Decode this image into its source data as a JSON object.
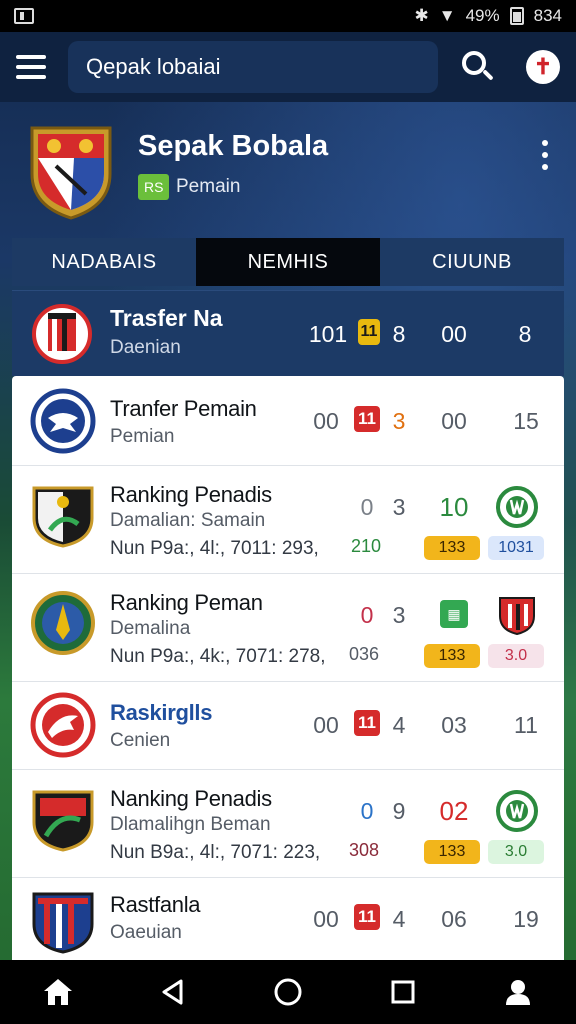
{
  "status": {
    "signal": "≈",
    "battery": "49%",
    "time": "834"
  },
  "search": {
    "value": "Qepak lobaiai"
  },
  "club": {
    "name": "Sepak Bobala",
    "badge": "RS",
    "subtitle": "Pemain"
  },
  "tabs": [
    {
      "label": "NADABAIS"
    },
    {
      "label": "NEMHIS"
    },
    {
      "label": "CIUUNB"
    }
  ],
  "featured": {
    "title": "Trasfer Na",
    "subtitle": "Daenian",
    "score_a": "101",
    "card": "11",
    "score_b": "8",
    "score_c": "00",
    "score_d": "8"
  },
  "rows": [
    {
      "title": "Tranfer Pemain",
      "subtitle": "Pemian",
      "n1": "00",
      "card": "11",
      "n2": "3",
      "n3": "00",
      "n4": "15"
    },
    {
      "title": "Ranking Penadis",
      "subtitle": "Damalian: Samain",
      "detail": "Nun P9a:, 4l:, 7011: 293,",
      "n1": "0",
      "n2": "3",
      "n3": "10",
      "d1": "210",
      "d2": "133",
      "d3": "1031"
    },
    {
      "title": "Ranking Peman",
      "subtitle": "Demalina",
      "detail": "Nun P9a:, 4k:, 7071: 278,",
      "n1": "0",
      "n2": "3",
      "d1": "036",
      "d2": "133",
      "d3": "3.0"
    },
    {
      "title": "Raskirglls",
      "subtitle": "Cenien",
      "n1": "00",
      "card": "11",
      "n2": "4",
      "n3": "03",
      "n4": "11"
    },
    {
      "title": "Nanking Penadis",
      "subtitle": "Dlamalihgn Beman",
      "detail": "Nun B9a:, 4l:, 7071: 223,",
      "n1": "0",
      "n2": "9",
      "n3": "02",
      "d1": "308",
      "d2": "133",
      "d3": "3.0"
    },
    {
      "title": "Rastfanla",
      "subtitle": "Oaeuian",
      "n1": "00",
      "card": "11",
      "n2": "4",
      "n3": "06",
      "n4": "19"
    }
  ],
  "icons": {
    "menu": "hamburger-icon",
    "search": "search-icon",
    "add": "red-cross-icon",
    "more": "kebab-menu-icon",
    "home": "home-icon",
    "back": "back-icon",
    "circle": "home-circle-icon",
    "recent": "recent-apps-icon",
    "profile": "profile-icon"
  },
  "colors": {
    "navy": "#0f2240",
    "tab_active": "#05080d",
    "red": "#d52b2b",
    "yellow": "#f2b51b",
    "green": "#33a852"
  }
}
